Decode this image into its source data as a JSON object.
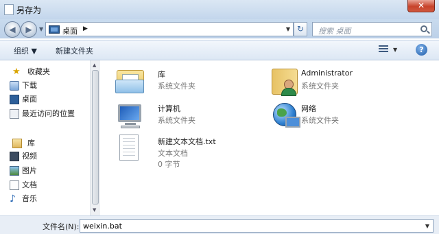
{
  "window": {
    "title": "另存为",
    "close_glyph": "✕"
  },
  "nav": {
    "back_glyph": "◀",
    "forward_glyph": "▶",
    "history_glyph": "▼",
    "address": {
      "location": "桌面",
      "separator": "▶",
      "dropdown_glyph": "▼"
    },
    "refresh_glyph": "↻",
    "search_placeholder": "搜索 桌面"
  },
  "toolbar": {
    "organize_label": "组织 ▼",
    "new_folder_label": "新建文件夹",
    "view_dropdown_glyph": "▼",
    "help_glyph": "?"
  },
  "sidebar": {
    "favorites": {
      "label": "收藏夹",
      "icon": "star-icon"
    },
    "favorites_items": [
      {
        "label": "下载",
        "icon": "download-icon"
      },
      {
        "label": "桌面",
        "icon": "desktop-icon"
      },
      {
        "label": "最近访问的位置",
        "icon": "recent-icon"
      }
    ],
    "libraries": {
      "label": "库",
      "icon": "library-icon"
    },
    "library_items": [
      {
        "label": "视频",
        "icon": "video-icon"
      },
      {
        "label": "图片",
        "icon": "picture-icon"
      },
      {
        "label": "文档",
        "icon": "document-icon"
      },
      {
        "label": "音乐",
        "icon": "music-icon"
      }
    ],
    "scroll_up_glyph": "▲",
    "scroll_down_glyph": "▼"
  },
  "items": [
    {
      "name": "库",
      "type": "系统文件夹",
      "icon": "library-icon"
    },
    {
      "name": "Administrator",
      "type": "系统文件夹",
      "icon": "user-folder-icon"
    },
    {
      "name": "计算机",
      "type": "系统文件夹",
      "icon": "computer-icon"
    },
    {
      "name": "网络",
      "type": "系统文件夹",
      "icon": "network-icon"
    },
    {
      "name": "新建文本文档.txt",
      "type": "文本文档",
      "size": "0 字节",
      "icon": "text-file-icon"
    }
  ],
  "filename": {
    "label": "文件名(N):",
    "value": "weixin.bat",
    "dropdown_glyph": "▼"
  }
}
